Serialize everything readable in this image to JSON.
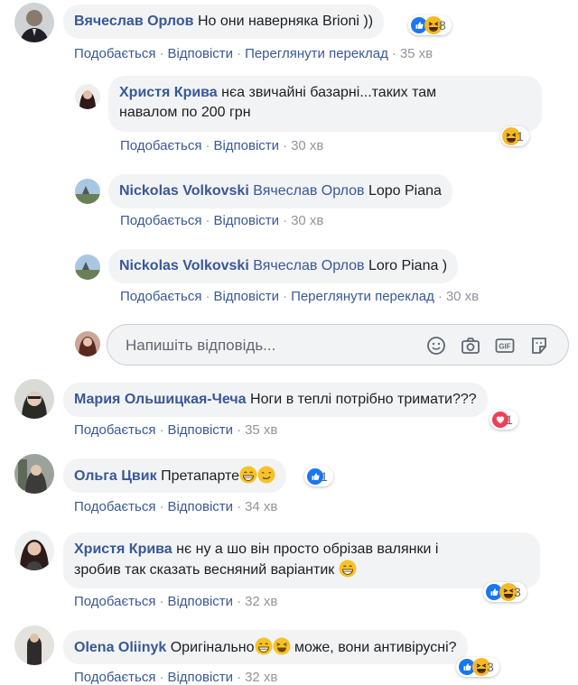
{
  "labels": {
    "like": "Подобається",
    "reply": "Відповісти",
    "translate": "Переглянути переклад"
  },
  "reply_placeholder": "Напишіть відповідь...",
  "comments": [
    {
      "name": "Вячеслав Орлов",
      "text": "Но они наверняка Brioni ))",
      "time": "35 хв",
      "reactions": "8"
    },
    {
      "name": "Христя Крива",
      "text_line1": "нєа звичайні базарні...таких там",
      "text_line2": "навалом по 200 грн",
      "time": "30 хв",
      "reactions": "1"
    },
    {
      "name": "Nickolas Volkovski",
      "mention": "Вячеслав Орлов",
      "text": "Lopo Piana",
      "time": "30 хв"
    },
    {
      "name": "Nickolas Volkovski",
      "mention": "Вячеслав Орлов",
      "text": "Loro Piana )",
      "time": "30 хв"
    },
    {
      "name": "Мария Ольшицкая-Чеча",
      "text": "Ноги в теплі потрібно тримати???",
      "time": "35 хв",
      "reactions": "1"
    },
    {
      "name": "Ольга Цвик",
      "text": "Претапарте",
      "time": "34 хв",
      "reactions": "1"
    },
    {
      "name": "Христя Крива",
      "text_line1": "нє ну а шо він просто обрізав валянки і",
      "text_line2": "зробив так сказать весняний варіантик",
      "time": "32 хв",
      "reactions": "3"
    },
    {
      "name": "Olena Oliinyk",
      "text_a": "Оригінально",
      "text_b": "може, вони антивірусні?",
      "time": "32 хв",
      "reactions": "3"
    }
  ],
  "colors": {
    "link": "#385898",
    "bubble": "#f2f3f5",
    "meta": "#90949c"
  }
}
